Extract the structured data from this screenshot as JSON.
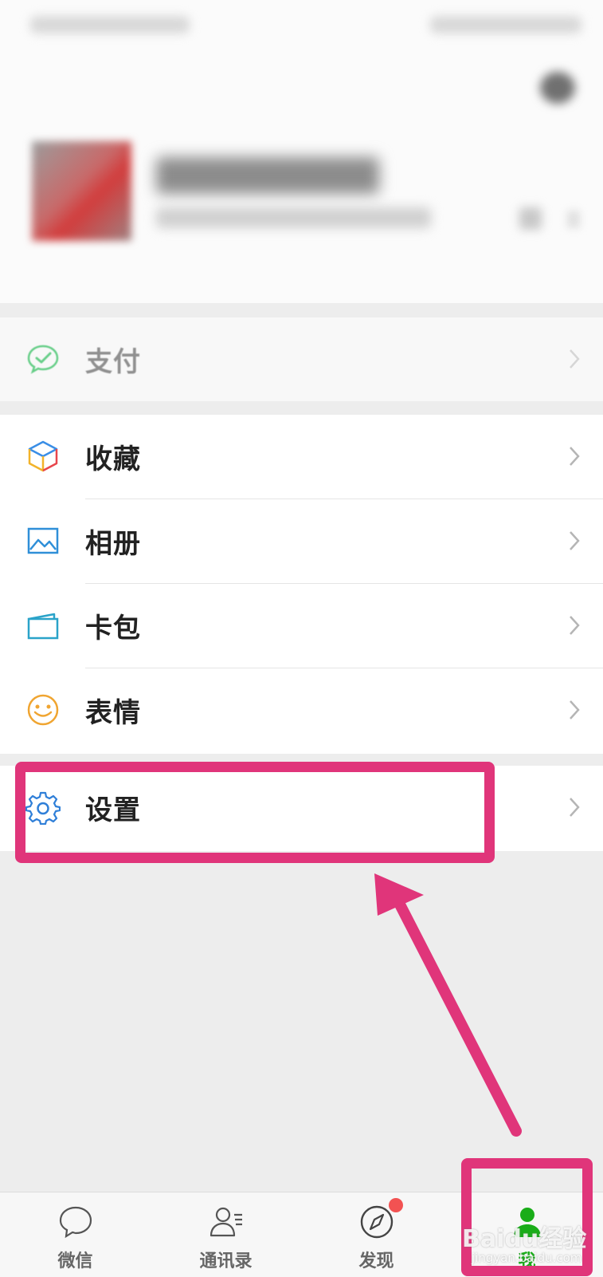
{
  "profile": {
    "avatar_icon": "avatar-pixelated",
    "camera_icon": "camera-icon"
  },
  "menu": {
    "pay": {
      "label": "支付",
      "icon": "wechat-pay-icon"
    },
    "items": [
      {
        "label": "收藏",
        "icon": "favorites-cube-icon"
      },
      {
        "label": "相册",
        "icon": "album-picture-icon"
      },
      {
        "label": "卡包",
        "icon": "card-wallet-icon"
      },
      {
        "label": "表情",
        "icon": "smiley-icon"
      }
    ],
    "settings": {
      "label": "设置",
      "icon": "gear-icon"
    }
  },
  "tabbar": {
    "tabs": [
      {
        "label": "微信",
        "icon": "chat-bubble-icon",
        "active": false
      },
      {
        "label": "通讯录",
        "icon": "contacts-icon",
        "active": false
      },
      {
        "label": "发现",
        "icon": "compass-icon",
        "active": false,
        "badge": "red-dot"
      },
      {
        "label": "我",
        "icon": "person-icon",
        "active": true
      }
    ]
  },
  "watermark": {
    "text": "Baidu经验",
    "sub": "jingyan.baidu.com"
  },
  "colors": {
    "accent_green": "#1aad19",
    "annotation_pink": "#e0357a",
    "badge_red": "#f25252"
  }
}
